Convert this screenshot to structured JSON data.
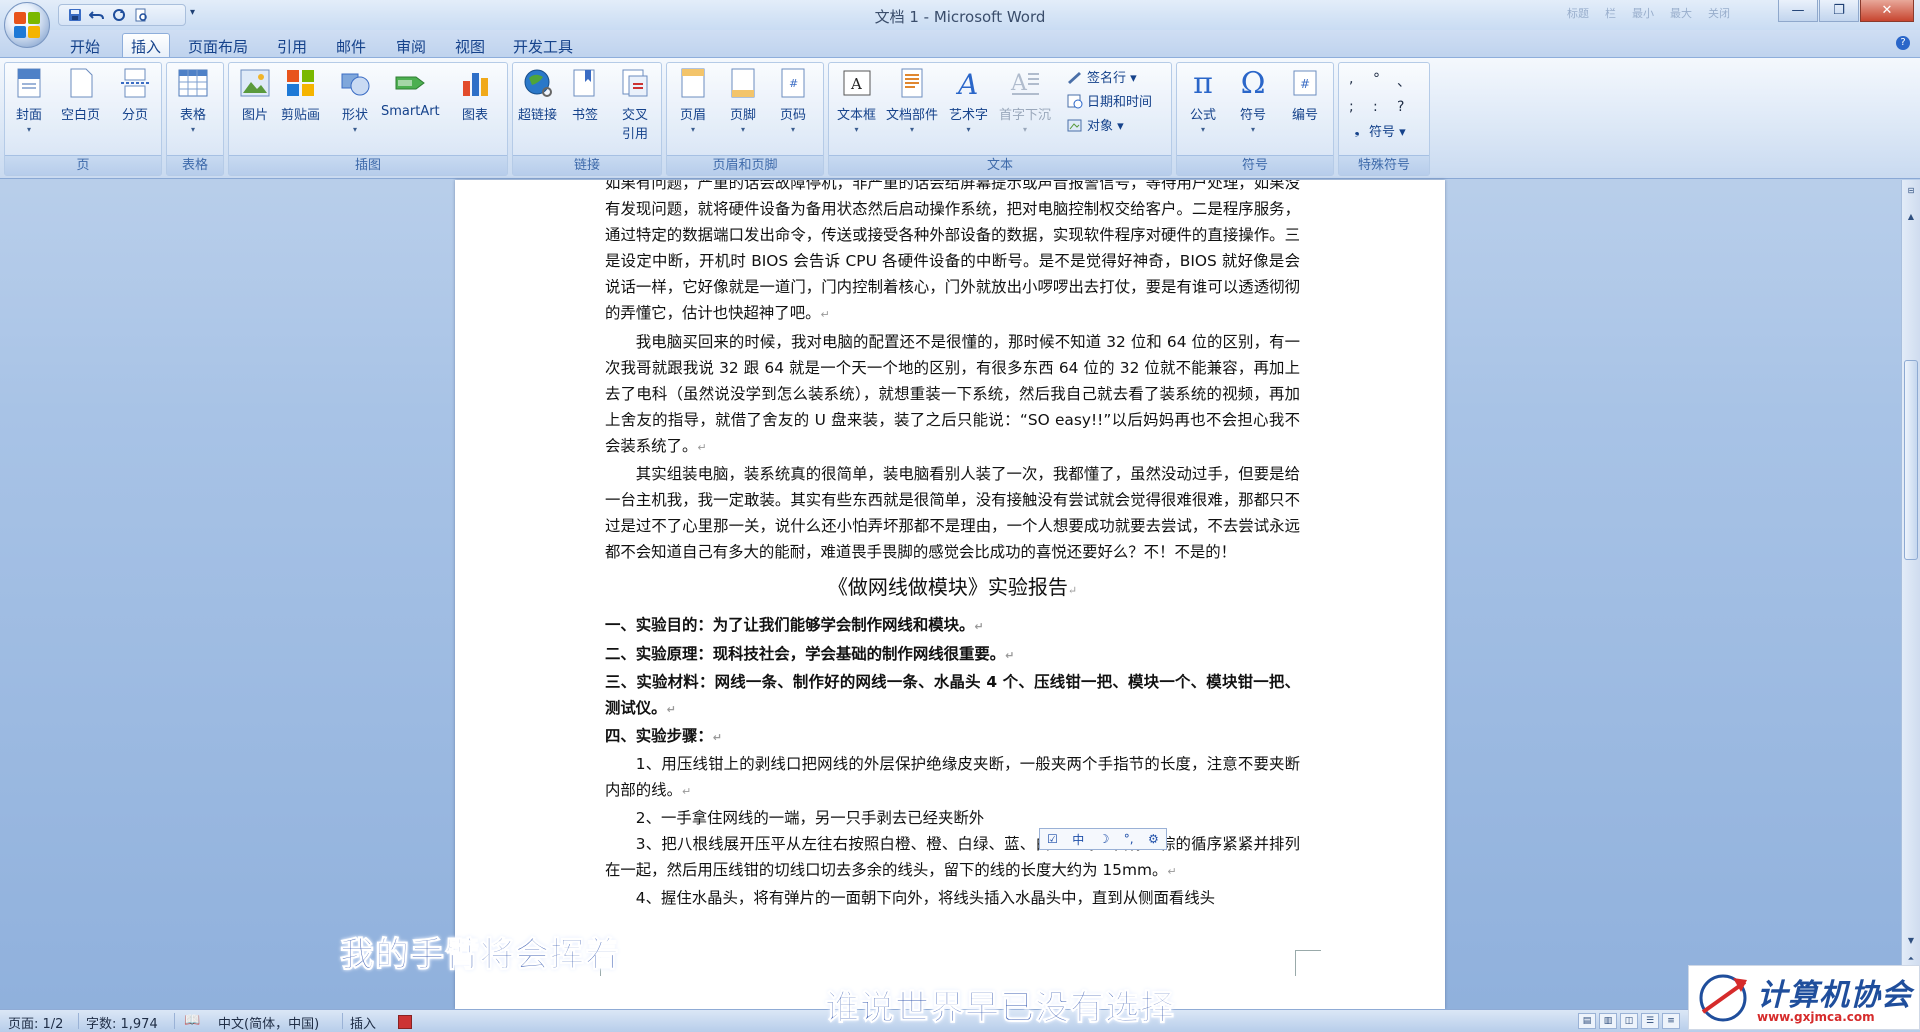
{
  "window": {
    "title": "文档 1 - Microsoft Word",
    "controls": [
      "—",
      "❐",
      "✕"
    ],
    "faint_controls": [
      "标题",
      "栏",
      "最小",
      "最大",
      "关闭"
    ]
  },
  "qat": {
    "save": "save-icon",
    "undo": "undo-icon",
    "redo": "redo-icon",
    "preview": "print-preview-icon",
    "more": "▾"
  },
  "tabs": [
    "开始",
    "插入",
    "页面布局",
    "引用",
    "邮件",
    "审阅",
    "视图",
    "开发工具"
  ],
  "active_tab": "插入",
  "ribbon": {
    "groups": [
      {
        "label": "页",
        "buttons": [
          "封面",
          "空白页",
          "分页"
        ]
      },
      {
        "label": "表格",
        "buttons": [
          "表格"
        ]
      },
      {
        "label": "插图",
        "buttons": [
          "图片",
          "剪贴画",
          "形状",
          "SmartArt",
          "图表"
        ]
      },
      {
        "label": "链接",
        "buttons": [
          "超链接",
          "书签",
          "交叉引用"
        ]
      },
      {
        "label": "页眉和页脚",
        "buttons": [
          "页眉",
          "页脚",
          "页码"
        ]
      },
      {
        "label": "文本",
        "buttons": [
          "文本框",
          "文档部件",
          "艺术字",
          "首字下沉"
        ],
        "small": [
          "签名行 ▾",
          "日期和时间",
          "对象 ▾"
        ]
      },
      {
        "label": "符号",
        "buttons": [
          "公式",
          "符号",
          "编号"
        ]
      },
      {
        "label": "特殊符号",
        "symbols": [
          ",",
          "°",
          "、",
          ";",
          ":",
          "?"
        ],
        "small": [
          "符号 ▾"
        ]
      }
    ]
  },
  "document": {
    "paragraphs": [
      "如果有问题，严重的话会故障停机，非严重的话会给屏幕提示或声音报警信号，等待用户处理，如果没有发现问题，就将硬件设备为备用状态然后启动操作系统，把对电脑控制权交给客户。二是程序服务，通过特定的数据端口发出命令，传送或接受各种外部设备的数据，实现软件程序对硬件的直接操作。三是设定中断，开机时 BIOS 会告诉 CPU 各硬件设备的中断号。是不是觉得好神奇，BIOS 就好像是会说话一样，它好像就是一道门，门内控制着核心，门外就放出小啰啰出去打仗，要是有谁可以透透彻彻的弄懂它，估计也快超神了吧。",
      "我电脑买回来的时候，我对电脑的配置还不是很懂的，那时候不知道 32 位和 64 位的区别，有一次我哥就跟我说 32 跟 64 就是一个天一个地的区别，有很多东西 64 位的 32 位就不能兼容，再加上去了电科（虽然说没学到怎么装系统），就想重装一下系统，然后我自己就去看了装系统的视频，再加上舍友的指导，就借了舍友的 U 盘来装，装了之后只能说：“SO easy!!”以后妈妈再也不会担心我不会装系统了。",
      "其实组装电脑，装系统真的很简单，装电脑看别人装了一次，我都懂了，虽然没动过手，但要是给一台主机我，我一定敢装。其实有些东西就是很简单，没有接触没有尝试就会觉得很难很难，那都只不过是过不了心里那一关，说什么还小怕弄坏那都不是理由，一个人想要成功就要去尝试，不去尝试永远都不会知道自己有多大的能耐，难道畏手畏脚的感觉会比成功的喜悦还要好么？不！不是的！"
    ],
    "heading": "《做网线做模块》实验报告",
    "items": [
      "一、实验目的：为了让我们能够学会制作网线和模块。",
      "二、实验原理：现科技社会，学会基础的制作网线很重要。",
      "三、实验材料：网线一条、制作好的网线一条、水晶头 4 个、压线钳一把、模块一个、模块钳一把、测试仪。",
      "四、实验步骤："
    ],
    "steps": [
      "1、用压线钳上的剥线口把网线的外层保护绝缘皮夹断，一般夹两个手指节的长度，注意不要夹断内部的线。",
      "2、一手拿住网线的一端，另一只手剥去已经夹断外",
      "3、把八根线展开压平从左往右按照白橙、橙、白绿、蓝、白蓝、绿、白棕、棕的循序紧紧并排列在一起，然后用压线钳的切线口切去多余的线头，留下的线的长度大约为 15mm。",
      "4、握住水晶头，将有弹片的一面朝下向外，将线头插入水晶头中，直到从侧面看线头"
    ],
    "paragraph_mark": "↵"
  },
  "ime_toolbar": [
    "☑",
    "中",
    "☽",
    "°,",
    "⚙"
  ],
  "statusbar": {
    "page": "页面: 1/2",
    "words": "字数: 1,974",
    "language": "中文(简体，中国)",
    "mode": "插入"
  },
  "overlay": {
    "lyric1": "我的手臂将会挥着",
    "lyric2": "谁说世界早已没有选择",
    "watermark_text": "计算机协会",
    "watermark_url": "www.gxjmca.com"
  },
  "colors": {
    "accent": "#15428b",
    "ribbon_bg": "#dbe7f6",
    "lyric": "#3d5fb3"
  }
}
